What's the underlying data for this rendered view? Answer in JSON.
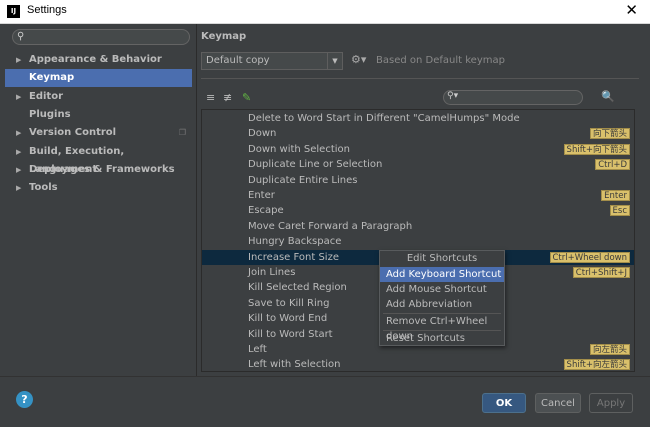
{
  "window": {
    "logo_text": "IJ",
    "title": "Settings",
    "close_glyph": "✕"
  },
  "sidebar": {
    "search_placeholder": "",
    "items": [
      {
        "label": "Appearance & Behavior",
        "expandable": true
      },
      {
        "label": "Keymap",
        "expandable": false,
        "selected": true
      },
      {
        "label": "Editor",
        "expandable": true
      },
      {
        "label": "Plugins",
        "expandable": false
      },
      {
        "label": "Version Control",
        "expandable": true
      },
      {
        "label": "Build, Execution, Deployment",
        "expandable": true
      },
      {
        "label": "Languages & Frameworks",
        "expandable": true
      },
      {
        "label": "Tools",
        "expandable": true
      }
    ]
  },
  "keymap": {
    "heading": "Keymap",
    "scheme_value": "Default copy",
    "based_on": "Based on Default keymap",
    "filter_placeholder": ""
  },
  "actions": [
    {
      "name": "Delete to Word Start in Different \"CamelHumps\" Mode",
      "shortcut": ""
    },
    {
      "name": "Down",
      "shortcut": "向下箭头"
    },
    {
      "name": "Down with Selection",
      "shortcut": "Shift+向下箭头"
    },
    {
      "name": "Duplicate Line or Selection",
      "shortcut": "Ctrl+D"
    },
    {
      "name": "Duplicate Entire Lines",
      "shortcut": ""
    },
    {
      "name": "Enter",
      "shortcut": "Enter"
    },
    {
      "name": "Escape",
      "shortcut": "Esc"
    },
    {
      "name": "Move Caret Forward a Paragraph",
      "shortcut": ""
    },
    {
      "name": "Hungry Backspace",
      "shortcut": ""
    },
    {
      "name": "Increase Font Size",
      "shortcut": "Ctrl+Wheel down",
      "selected": true
    },
    {
      "name": "Join Lines",
      "shortcut": "Ctrl+Shift+J"
    },
    {
      "name": "Kill Selected Region",
      "shortcut": ""
    },
    {
      "name": "Save to Kill Ring",
      "shortcut": ""
    },
    {
      "name": "Kill to Word End",
      "shortcut": ""
    },
    {
      "name": "Kill to Word Start",
      "shortcut": ""
    },
    {
      "name": "Left",
      "shortcut": "向左箭头"
    },
    {
      "name": "Left with Selection",
      "shortcut": "Shift+向左箭头"
    }
  ],
  "context_menu": {
    "header": "Edit Shortcuts",
    "items": [
      {
        "label": "Add Keyboard Shortcut",
        "highlighted": true
      },
      {
        "label": "Add Mouse Shortcut"
      },
      {
        "label": "Add Abbreviation"
      },
      {
        "label": "Remove Ctrl+Wheel down",
        "separator_before": true
      },
      {
        "label": "Reset Shortcuts",
        "separator_before": true
      }
    ]
  },
  "buttons": {
    "ok": "OK",
    "cancel": "Cancel",
    "apply": "Apply",
    "help": "?"
  },
  "colors": {
    "accent": "#4b6eaf",
    "background": "#3c3f41",
    "shortcut_badge": "#d9c06b"
  }
}
